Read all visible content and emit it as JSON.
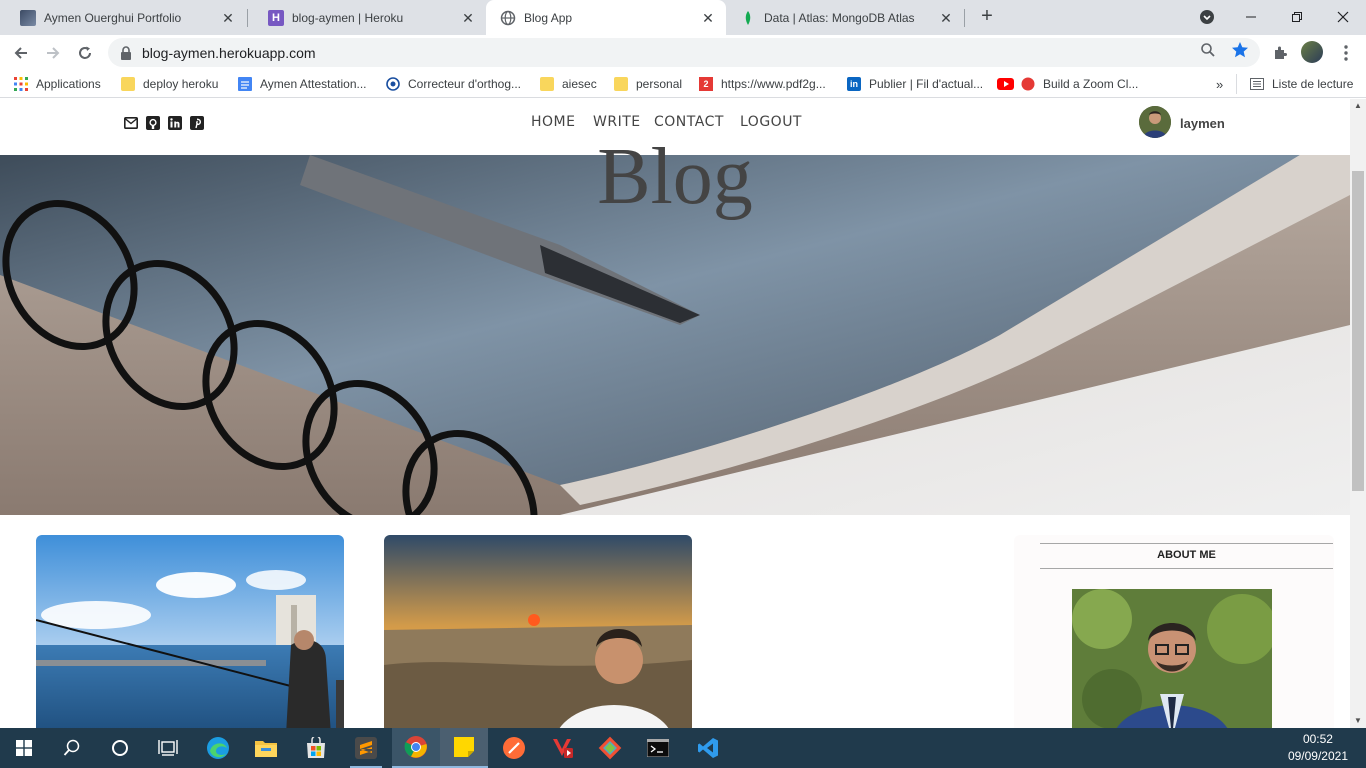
{
  "browser": {
    "tabs": [
      {
        "title": "Aymen Ouerghui Portfolio",
        "favicon": "portfolio-photo-icon",
        "active": false
      },
      {
        "title": "blog-aymen | Heroku",
        "favicon": "heroku-icon",
        "active": false
      },
      {
        "title": "Blog App",
        "favicon": "globe-icon",
        "active": true
      },
      {
        "title": "Data | Atlas: MongoDB Atlas",
        "favicon": "mongodb-leaf-icon",
        "active": false
      }
    ],
    "url": "blog-aymen.herokuapp.com",
    "bookmarks": [
      {
        "label": "Applications",
        "icon": "apps-grid-icon"
      },
      {
        "label": "deploy heroku",
        "icon": "folder-icon"
      },
      {
        "label": "Aymen Attestation...",
        "icon": "docs-icon"
      },
      {
        "label": "Correcteur d'orthog...",
        "icon": "scribens-icon"
      },
      {
        "label": "aiesec",
        "icon": "folder-icon"
      },
      {
        "label": "personal",
        "icon": "folder-icon"
      },
      {
        "label": "https://www.pdf2g...",
        "icon": "pdf2go-icon"
      },
      {
        "label": "Publier | Fil d'actual...",
        "icon": "linkedin-icon"
      },
      {
        "label": "Build a Zoom Cl...",
        "icon": "youtube-icon"
      }
    ],
    "reading_list": "Liste de lecture",
    "colors": {
      "tabstrip": "#dee1e6",
      "bookmark_star": "#1a73e8"
    }
  },
  "site": {
    "nav": [
      "HOME",
      "WRITE",
      "CONTACT",
      "LOGOUT"
    ],
    "social_icons": [
      "email-icon",
      "github-icon",
      "linkedin-icon",
      "pinterest-icon"
    ],
    "username": "laymen",
    "hero_title": "Blog",
    "sidebar_title": "ABOUT ME"
  },
  "taskbar": {
    "time": "00:52",
    "date": "09/09/2021",
    "apps": [
      "start",
      "search",
      "cortana",
      "task-view",
      "edge",
      "file-explorer",
      "store",
      "sublime-text",
      "chrome",
      "sticky-notes",
      "postman",
      "vlc",
      "git",
      "terminal",
      "vscode"
    ],
    "colors": {
      "background": "#203a4c"
    }
  }
}
